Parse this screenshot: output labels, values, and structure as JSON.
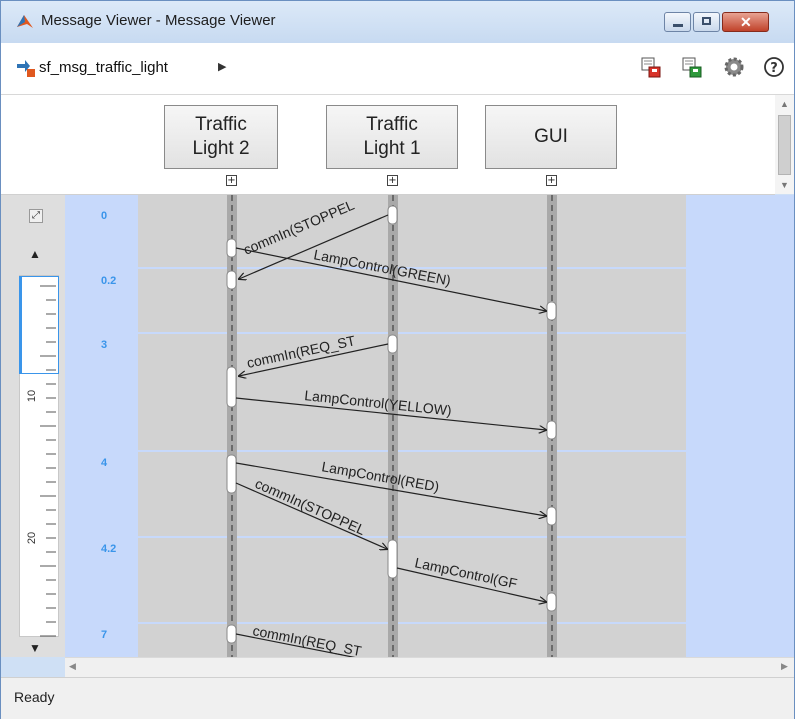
{
  "window": {
    "title": "Message Viewer - Message Viewer",
    "controls": [
      "minimize",
      "maximize",
      "close"
    ],
    "close_color": "#c0422a"
  },
  "toolbar": {
    "model_name": "sf_msg_traffic_light",
    "buttons": [
      {
        "name": "export-icon"
      },
      {
        "name": "import-icon"
      },
      {
        "name": "settings-gear-icon"
      },
      {
        "name": "help-icon"
      }
    ]
  },
  "lifelines": [
    {
      "label": "Traffic\nLight 2"
    },
    {
      "label": "Traffic\nLight 1"
    },
    {
      "label": "GUI"
    }
  ],
  "time_labels": [
    "0",
    "0.2",
    "3",
    "4",
    "4.2",
    "7"
  ],
  "ruler": {
    "labels": [
      "10",
      "20"
    ]
  },
  "messages": [
    {
      "text": "commIn(STOPPEL",
      "from": "Traffic Light 1",
      "to": "Traffic Light 2"
    },
    {
      "text": "LampControl(GREEN)",
      "from": "Traffic Light 2",
      "to": "GUI"
    },
    {
      "text": "commIn(REQ_ST",
      "from": "Traffic Light 1",
      "to": "Traffic Light 2"
    },
    {
      "text": "LampControl(YELLOW)",
      "from": "Traffic Light 2",
      "to": "GUI"
    },
    {
      "text": "LampControl(RED)",
      "from": "Traffic Light 2",
      "to": "GUI"
    },
    {
      "text": "commIn(STOPPEL",
      "from": "Traffic Light 2",
      "to": "Traffic Light 1"
    },
    {
      "text": "LampControl(GF",
      "from": "Traffic Light 1",
      "to": "GUI"
    },
    {
      "text": "commIn(REQ_ST",
      "from": "Traffic Light 2",
      "to": "Traffic Light 1"
    }
  ],
  "status": {
    "text": "Ready"
  },
  "colors": {
    "accent": "#3a95ea",
    "canvas": "#d2d2d2",
    "background": "#c7d9fb"
  }
}
